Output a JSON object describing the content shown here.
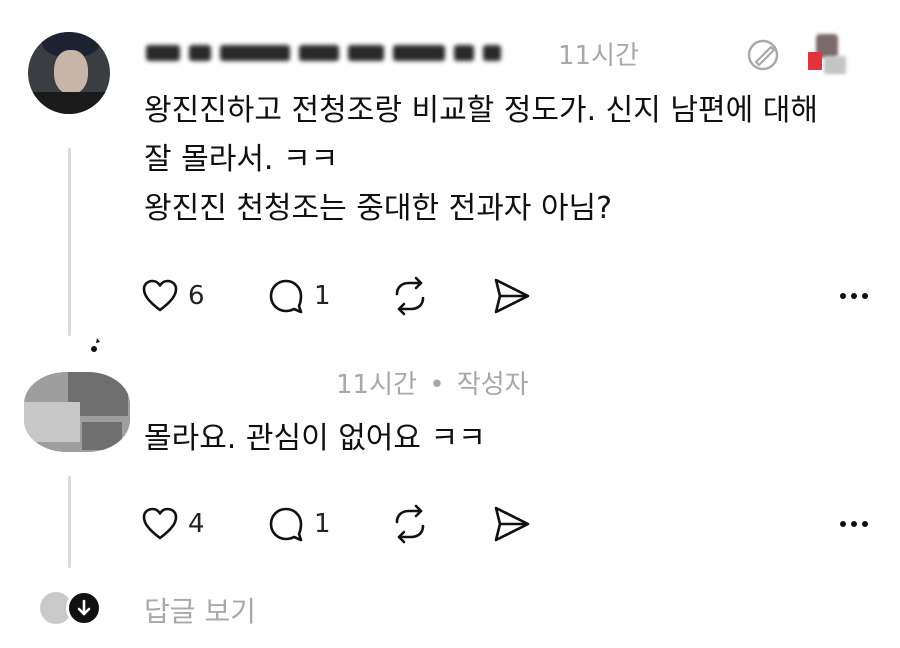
{
  "comment1": {
    "time": "11시간",
    "text_lines": [
      "왕진진하고 전청조랑 비교할 정도가. 신지 남편에 대해",
      "잘 몰라서. ㅋㅋ",
      "왕진진 천청조는 중대한 전과자 아님?"
    ],
    "likes": "6",
    "replies": "1"
  },
  "comment2": {
    "time": "11시간",
    "separator": "•",
    "author_tag": "작성자",
    "text": "몰라요. 관심이 없어요 ㅋㅋ",
    "likes": "4",
    "replies": "1"
  },
  "view_replies": {
    "label": "답글 보기"
  },
  "icons": {
    "like": "heart-icon",
    "reply": "speech-bubble-icon",
    "repost": "repost-arrows-icon",
    "share": "send-icon",
    "more": "ellipsis-icon",
    "follow": "pencil-circle-icon",
    "expand": "arrow-down-icon"
  },
  "colors": {
    "muted": "#a8a8a8",
    "text": "#101010",
    "thread_line": "#d9d9d9",
    "badge_red": "#e2323a"
  }
}
